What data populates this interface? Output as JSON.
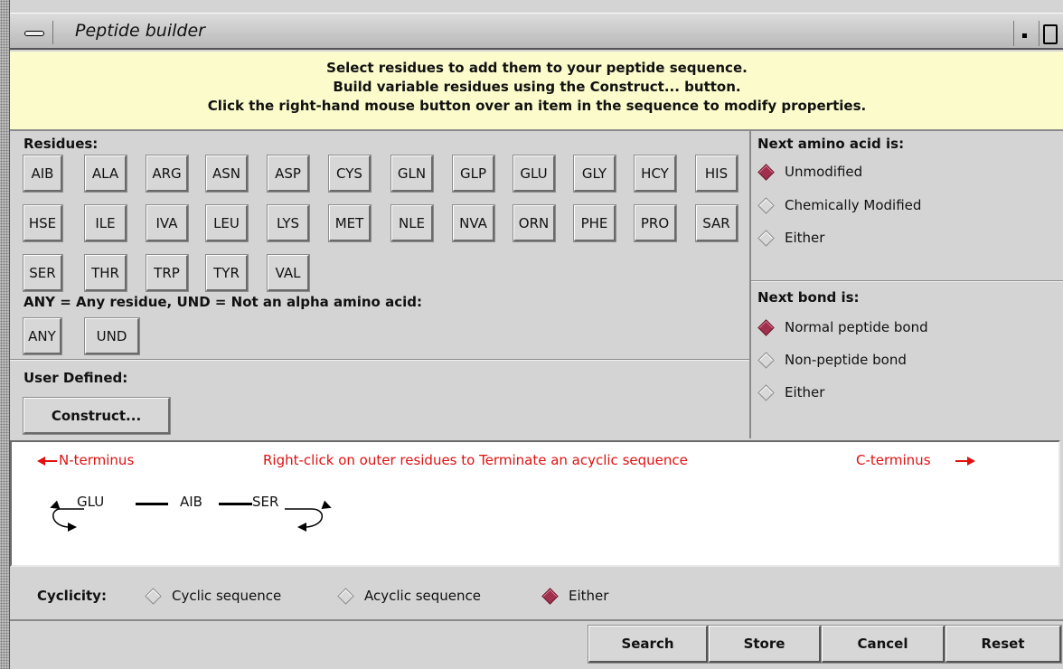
{
  "window": {
    "title": "Peptide builder"
  },
  "info": {
    "line1": "Select residues to add them to your peptide sequence.",
    "line2": "Build variable residues using the Construct... button.",
    "line3": "Click the right-hand mouse button over an item in the sequence to modify properties."
  },
  "residues": {
    "header": "Residues:",
    "row1": [
      "AIB",
      "ALA",
      "ARG",
      "ASN",
      "ASP",
      "CYS",
      "GLN",
      "GLP",
      "GLU",
      "GLY",
      "HCY",
      "HIS"
    ],
    "row2": [
      "HSE",
      "ILE",
      "IVA",
      "LEU",
      "LYS",
      "MET",
      "NLE",
      "NVA",
      "ORN",
      "PHE",
      "PRO",
      "SAR"
    ],
    "row3": [
      "SER",
      "THR",
      "TRP",
      "TYR",
      "VAL"
    ]
  },
  "special": {
    "header": "ANY = Any residue, UND = Not an alpha amino acid:",
    "buttons": [
      "ANY",
      "UND"
    ]
  },
  "user_defined": {
    "header": "User Defined:",
    "construct_label": "Construct..."
  },
  "next_amino_acid": {
    "header": "Next amino acid is:",
    "options": [
      "Unmodified",
      "Chemically Modified",
      "Either"
    ],
    "selected": "Unmodified"
  },
  "next_bond": {
    "header": "Next bond is:",
    "options": [
      "Normal peptide bond",
      "Non-peptide bond",
      "Either"
    ],
    "selected": "Normal peptide bond"
  },
  "sequence": {
    "n_terminus": "N-terminus",
    "hint": "Right-click on outer residues to Terminate an acyclic sequence",
    "c_terminus": "C-terminus",
    "residues": [
      "GLU",
      "AIB",
      "SER"
    ],
    "accent": "#e01010"
  },
  "cyclicity": {
    "label": "Cyclicity:",
    "options": [
      "Cyclic sequence",
      "Acyclic sequence",
      "Either"
    ],
    "selected": "Either"
  },
  "actions": {
    "search": "Search",
    "store": "Store",
    "cancel": "Cancel",
    "reset": "Reset"
  }
}
